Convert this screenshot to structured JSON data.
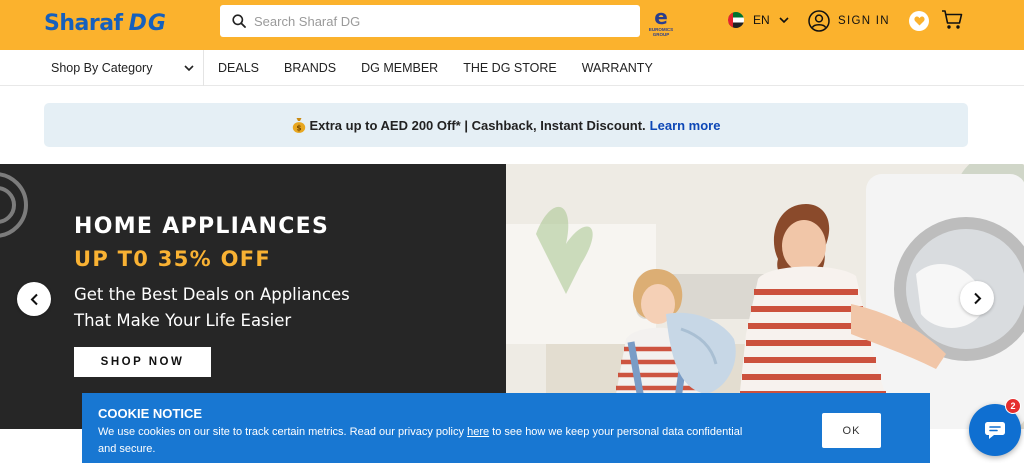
{
  "header": {
    "logo_part1": "Sharaf",
    "logo_part2": "DG",
    "search_placeholder": "Search Sharaf DG",
    "group_logo_big": "e",
    "group_logo_small": "EUROMICS GROUP",
    "language": "EN",
    "signin_label": "SIGN IN",
    "brand_color": "#fbb22d",
    "logo_color": "#1560bd"
  },
  "nav": {
    "category_label": "Shop By Category",
    "items": [
      "DEALS",
      "BRANDS",
      "DG MEMBER",
      "THE DG STORE",
      "WARRANTY"
    ]
  },
  "promo": {
    "text": "Extra up to AED 200 Off* | Cashback, Instant Discount.",
    "link": "Learn more",
    "link_color": "#0d47b6"
  },
  "hero": {
    "title": "HOME APPLIANCES",
    "offer": "UP T0 35% OFF",
    "subtitle_line1": "Get the Best Deals on Appliances",
    "subtitle_line2": "That Make Your Life Easier",
    "button": "SHOP NOW",
    "offer_color": "#f9b233"
  },
  "cookie": {
    "title": "COOKIE NOTICE",
    "text_before": "We use cookies on our site to track certain metrics. Read our privacy policy",
    "link": "here",
    "text_after": "to see how we keep your personal data confidential and secure.",
    "ok_label": "OK",
    "bg_color": "#1877d2"
  },
  "chat": {
    "badge_count": "2"
  }
}
